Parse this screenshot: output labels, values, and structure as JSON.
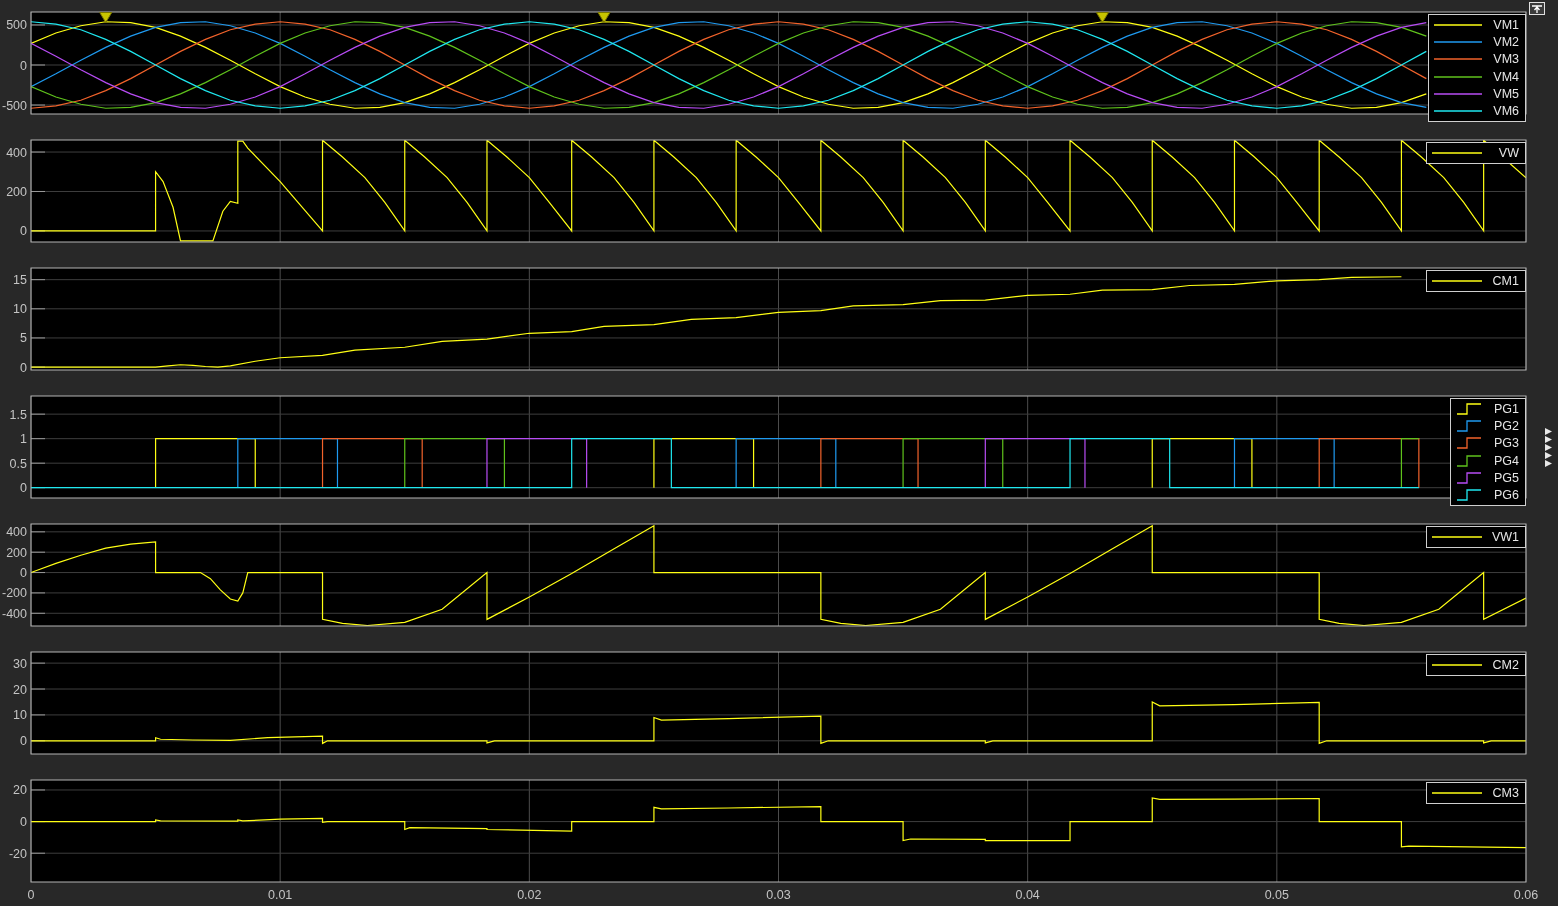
{
  "panels": [
    {
      "kind": "line",
      "peak_markers": true,
      "chart_data": {
        "type": "line",
        "grid": true,
        "xlim": [
          0,
          0.06
        ],
        "ylim": [
          -612,
          662
        ],
        "yticks": [
          -500,
          0,
          500
        ],
        "x": [
          0,
          0.001,
          0.002,
          0.003,
          0.004,
          0.005,
          0.006,
          0.007,
          0.008,
          0.009,
          0.01,
          0.011,
          0.012,
          0.013,
          0.014,
          0.015,
          0.016,
          0.017,
          0.018,
          0.019,
          0.02,
          0.021,
          0.022,
          0.023,
          0.024,
          0.025,
          0.026,
          0.027,
          0.028,
          0.029,
          0.03,
          0.031,
          0.032,
          0.033,
          0.034,
          0.035,
          0.036,
          0.037,
          0.038,
          0.039,
          0.04,
          0.041,
          0.042,
          0.043,
          0.044,
          0.045,
          0.046,
          0.047,
          0.048,
          0.049,
          0.05,
          0.051,
          0.052,
          0.053,
          0.054,
          0.055,
          0.056
        ],
        "series": [
          {
            "name": "VM1",
            "color": "#ffff14",
            "values": [
              270,
              400,
              490,
              540,
              530,
              470,
              360,
              220,
              60,
              -110,
              -270,
              -400,
              -490,
              -540,
              -530,
              -470,
              -360,
              -220,
              -60,
              110,
              270,
              400,
              490,
              540,
              530,
              470,
              360,
              220,
              60,
              -110,
              -270,
              -400,
              -490,
              -540,
              -530,
              -470,
              -360,
              -220,
              -60,
              110,
              270,
              400,
              490,
              540,
              530,
              470,
              360,
              220,
              60,
              -110,
              -270,
              -400,
              -490,
              -540,
              -530,
              -470,
              -360
            ]
          },
          {
            "name": "VM2",
            "color": "#1f9af0",
            "values": [
              -270,
              -110,
              60,
              220,
              360,
              470,
              530,
              540,
              490,
              400,
              270,
              110,
              -60,
              -220,
              -360,
              -470,
              -530,
              -540,
              -490,
              -400,
              -270,
              -110,
              60,
              220,
              360,
              470,
              530,
              540,
              490,
              400,
              270,
              110,
              -60,
              -220,
              -360,
              -470,
              -530,
              -540,
              -490,
              -400,
              -270,
              -110,
              60,
              220,
              360,
              470,
              530,
              540,
              490,
              400,
              270,
              110,
              -60,
              -220,
              -360,
              -470,
              -530
            ]
          },
          {
            "name": "VM3",
            "color": "#f2632b",
            "values": [
              -540,
              -510,
              -440,
              -320,
              -170,
              0,
              170,
              320,
              440,
              510,
              540,
              510,
              440,
              320,
              170,
              0,
              -170,
              -320,
              -440,
              -510,
              -540,
              -510,
              -440,
              -320,
              -170,
              0,
              170,
              320,
              440,
              510,
              540,
              510,
              440,
              320,
              170,
              0,
              -170,
              -320,
              -440,
              -510,
              -540,
              -510,
              -440,
              -320,
              -170,
              0,
              170,
              320,
              440,
              510,
              540,
              510,
              440,
              320,
              170,
              0,
              -170
            ]
          },
          {
            "name": "VM4",
            "color": "#5fc21c",
            "values": [
              -270,
              -400,
              -490,
              -540,
              -530,
              -470,
              -360,
              -220,
              -60,
              110,
              270,
              400,
              490,
              540,
              530,
              470,
              360,
              220,
              60,
              -110,
              -270,
              -400,
              -490,
              -540,
              -530,
              -470,
              -360,
              -220,
              -60,
              110,
              270,
              400,
              490,
              540,
              530,
              470,
              360,
              220,
              60,
              -110,
              -270,
              -400,
              -490,
              -540,
              -530,
              -470,
              -360,
              -220,
              -60,
              110,
              270,
              400,
              490,
              540,
              530,
              470,
              360
            ]
          },
          {
            "name": "VM5",
            "color": "#b84cf5",
            "values": [
              270,
              110,
              -60,
              -220,
              -360,
              -470,
              -530,
              -540,
              -490,
              -400,
              -270,
              -110,
              60,
              220,
              360,
              470,
              530,
              540,
              490,
              400,
              270,
              110,
              -60,
              -220,
              -360,
              -470,
              -530,
              -540,
              -490,
              -400,
              -270,
              -110,
              60,
              220,
              360,
              470,
              530,
              540,
              490,
              400,
              270,
              110,
              -60,
              -220,
              -360,
              -470,
              -530,
              -540,
              -490,
              -400,
              -270,
              -110,
              60,
              220,
              360,
              470,
              530
            ]
          },
          {
            "name": "VM6",
            "color": "#1fe8f0",
            "values": [
              540,
              510,
              440,
              320,
              170,
              0,
              -170,
              -320,
              -440,
              -510,
              -540,
              -510,
              -440,
              -320,
              -170,
              0,
              170,
              320,
              440,
              510,
              540,
              510,
              440,
              320,
              170,
              0,
              -170,
              -320,
              -440,
              -510,
              -540,
              -510,
              -440,
              -320,
              -170,
              0,
              170,
              320,
              440,
              510,
              540,
              510,
              440,
              320,
              170,
              0,
              -170,
              -320,
              -440,
              -510,
              -540,
              -510,
              -440,
              -320,
              -170,
              0,
              170
            ]
          }
        ]
      }
    },
    {
      "kind": "line",
      "chart_data": {
        "type": "line",
        "grid": true,
        "xlim": [
          0,
          0.06
        ],
        "ylim": [
          -56,
          461
        ],
        "yticks": [
          0,
          200,
          400
        ],
        "x": [
          0,
          0.005,
          0.005,
          0.0053,
          0.0057,
          0.006,
          0.0073,
          0.0077,
          0.008,
          0.0083,
          0.0083,
          0.0085,
          0.0087,
          0.01,
          0.0117,
          0.0117,
          0.0125,
          0.0134,
          0.0142,
          0.015,
          0.015,
          0.0158,
          0.0167,
          0.0175,
          0.0183,
          0.0183,
          0.0191,
          0.02,
          0.0208,
          0.0217,
          0.0217,
          0.0225,
          0.0234,
          0.0242,
          0.025,
          0.025,
          0.0258,
          0.0267,
          0.0275,
          0.0283,
          0.0283,
          0.0291,
          0.03,
          0.0308,
          0.0317,
          0.0317,
          0.0325,
          0.0334,
          0.0342,
          0.035,
          0.035,
          0.0358,
          0.0367,
          0.0375,
          0.0383,
          0.0383,
          0.0391,
          0.04,
          0.0408,
          0.0417,
          0.0417,
          0.0425,
          0.0434,
          0.0442,
          0.045,
          0.045,
          0.0458,
          0.0467,
          0.0475,
          0.0483,
          0.0483,
          0.0491,
          0.05,
          0.0508,
          0.0517,
          0.0517,
          0.0525,
          0.0534,
          0.0542,
          0.055,
          0.055,
          0.0558,
          0.0567,
          0.0575,
          0.0583,
          0.0583,
          0.06
        ],
        "series": [
          {
            "name": "VW",
            "color": "#ffff14",
            "values": [
              0,
              0,
              300,
              250,
              120,
              -50,
              -50,
              100,
              150,
              140,
              455,
              455,
              420,
              250,
              0,
              460,
              375,
              270,
              145,
              0,
              460,
              375,
              270,
              145,
              0,
              460,
              375,
              270,
              145,
              0,
              460,
              375,
              270,
              145,
              0,
              460,
              375,
              270,
              145,
              0,
              460,
              375,
              270,
              145,
              0,
              460,
              375,
              270,
              145,
              0,
              460,
              375,
              270,
              145,
              0,
              460,
              375,
              270,
              145,
              0,
              460,
              375,
              270,
              145,
              0,
              460,
              375,
              270,
              145,
              0,
              460,
              375,
              270,
              145,
              0,
              460,
              375,
              270,
              145,
              0,
              460,
              375,
              270,
              145,
              0,
              460,
              270
            ]
          }
        ]
      }
    },
    {
      "kind": "line",
      "chart_data": {
        "type": "line",
        "grid": true,
        "xlim": [
          0,
          0.06
        ],
        "ylim": [
          -0.5,
          17
        ],
        "yticks": [
          0,
          5,
          10,
          15
        ],
        "x": [
          0,
          0.005,
          0.0055,
          0.006,
          0.0065,
          0.007,
          0.0075,
          0.008,
          0.009,
          0.01,
          0.0117,
          0.013,
          0.015,
          0.0165,
          0.0183,
          0.02,
          0.0217,
          0.023,
          0.025,
          0.0265,
          0.0283,
          0.03,
          0.0317,
          0.033,
          0.035,
          0.0365,
          0.0383,
          0.04,
          0.0417,
          0.043,
          0.045,
          0.0465,
          0.0483,
          0.05,
          0.0517,
          0.053,
          0.055
        ],
        "series": [
          {
            "name": "CM1",
            "color": "#ffff14",
            "values": [
              0,
              0,
              0.2,
              0.4,
              0.3,
              0.1,
              0,
              0.2,
              1,
              1.6,
              2,
              2.9,
              3.4,
              4.4,
              4.8,
              5.8,
              6.1,
              7,
              7.3,
              8.2,
              8.5,
              9.4,
              9.7,
              10.5,
              10.7,
              11.4,
              11.5,
              12.3,
              12.5,
              13.2,
              13.3,
              14,
              14.2,
              14.8,
              15,
              15.4,
              15.5
            ]
          }
        ]
      }
    },
    {
      "kind": "step",
      "side_arrows": true,
      "chart_data": {
        "type": "line",
        "grid": true,
        "xlim": [
          0,
          0.06
        ],
        "ylim": [
          -0.21,
          1.87
        ],
        "yticks": [
          0,
          0.5,
          1,
          1.5
        ],
        "x": [
          0,
          0.005,
          0.005,
          0.0083,
          0.0083,
          0.009,
          0.009,
          0.0117,
          0.0117,
          0.0123,
          0.0123,
          0.015,
          0.015,
          0.0157,
          0.0157,
          0.0183,
          0.0183,
          0.019,
          0.019,
          0.0217,
          0.0217,
          0.0223,
          0.0223,
          0.025,
          0.025,
          0.0257,
          0.0257,
          0.0283,
          0.0283,
          0.029,
          0.029,
          0.0317,
          0.0317,
          0.0323,
          0.0323,
          0.035,
          0.035,
          0.0356,
          0.0356,
          0.0383,
          0.0383,
          0.039,
          0.039,
          0.0417,
          0.0417,
          0.0423,
          0.0423,
          0.045,
          0.045,
          0.0457,
          0.0457,
          0.0483,
          0.0483,
          0.049,
          0.049,
          0.0517,
          0.0517,
          0.0523,
          0.0523,
          0.055,
          0.055,
          0.0557,
          0.0557
        ],
        "series": [
          {
            "name": "PG1",
            "color": "#ffff14",
            "values": [
              null,
              0,
              1,
              1,
              1,
              1,
              0,
              null,
              null,
              null,
              null,
              null,
              null,
              null,
              null,
              null,
              null,
              null,
              null,
              null,
              null,
              null,
              null,
              0,
              1,
              1,
              1,
              1,
              1,
              1,
              0,
              null,
              null,
              null,
              null,
              null,
              null,
              null,
              null,
              null,
              null,
              null,
              null,
              null,
              null,
              null,
              null,
              0,
              1,
              1,
              1,
              1,
              1,
              1,
              0,
              null,
              null,
              null,
              null,
              null,
              null,
              null,
              null
            ]
          },
          {
            "name": "PG2",
            "color": "#1f9af0",
            "values": [
              null,
              null,
              null,
              0,
              1,
              1,
              1,
              1,
              1,
              1,
              0,
              null,
              null,
              null,
              null,
              null,
              null,
              null,
              null,
              null,
              null,
              null,
              null,
              null,
              null,
              null,
              null,
              0,
              1,
              1,
              1,
              1,
              1,
              1,
              0,
              null,
              null,
              null,
              null,
              null,
              null,
              null,
              null,
              null,
              null,
              null,
              null,
              null,
              null,
              null,
              null,
              0,
              1,
              1,
              1,
              1,
              1,
              1,
              0,
              null,
              null,
              null,
              null
            ]
          },
          {
            "name": "PG3",
            "color": "#f2632b",
            "values": [
              null,
              null,
              null,
              null,
              null,
              null,
              null,
              0,
              1,
              1,
              1,
              1,
              1,
              1,
              0,
              null,
              null,
              null,
              null,
              null,
              null,
              null,
              null,
              null,
              null,
              null,
              null,
              null,
              null,
              null,
              null,
              0,
              1,
              1,
              1,
              1,
              1,
              1,
              0,
              null,
              null,
              null,
              null,
              null,
              null,
              null,
              null,
              null,
              null,
              null,
              null,
              null,
              null,
              null,
              null,
              0,
              1,
              1,
              1,
              1,
              1,
              1,
              0
            ]
          },
          {
            "name": "PG4",
            "color": "#5fc21c",
            "values": [
              null,
              null,
              null,
              null,
              null,
              null,
              null,
              null,
              null,
              null,
              null,
              0,
              1,
              1,
              1,
              1,
              1,
              1,
              0,
              null,
              null,
              null,
              null,
              null,
              null,
              null,
              null,
              null,
              null,
              null,
              null,
              null,
              null,
              null,
              null,
              0,
              1,
              1,
              1,
              1,
              1,
              1,
              0,
              null,
              null,
              null,
              null,
              null,
              null,
              null,
              null,
              null,
              null,
              null,
              null,
              null,
              null,
              null,
              null,
              0,
              1,
              1,
              1
            ]
          },
          {
            "name": "PG5",
            "color": "#b84cf5",
            "values": [
              null,
              null,
              null,
              null,
              null,
              null,
              null,
              null,
              null,
              null,
              null,
              null,
              null,
              null,
              null,
              0,
              1,
              1,
              1,
              1,
              1,
              1,
              0,
              null,
              null,
              null,
              null,
              null,
              null,
              null,
              null,
              null,
              null,
              null,
              null,
              null,
              null,
              null,
              null,
              0,
              1,
              1,
              1,
              1,
              1,
              1,
              0,
              null,
              null,
              null,
              null,
              null,
              null,
              null,
              null,
              null,
              null,
              null,
              null,
              null,
              null,
              null,
              null
            ]
          },
          {
            "name": "PG6",
            "color": "#1fe8f0",
            "values": [
              0,
              0,
              0,
              0,
              0,
              0,
              0,
              0,
              0,
              0,
              0,
              0,
              0,
              0,
              0,
              0,
              0,
              0,
              0,
              0,
              1,
              1,
              1,
              1,
              1,
              1,
              0,
              0,
              0,
              0,
              0,
              0,
              0,
              0,
              0,
              0,
              0,
              0,
              0,
              0,
              0,
              0,
              0,
              0,
              1,
              1,
              1,
              1,
              1,
              1,
              0,
              0,
              0,
              0,
              0,
              0,
              0,
              0,
              0,
              0,
              0,
              0,
              0
            ]
          }
        ]
      }
    },
    {
      "kind": "line",
      "chart_data": {
        "type": "line",
        "grid": true,
        "xlim": [
          0,
          0.06
        ],
        "ylim": [
          -525,
          477
        ],
        "yticks": [
          -400,
          -200,
          0,
          200,
          400
        ],
        "x": [
          0,
          0.001,
          0.002,
          0.003,
          0.004,
          0.005,
          0.005,
          0.0068,
          0.0072,
          0.0076,
          0.008,
          0.0083,
          0.0085,
          0.0087,
          0.0117,
          0.0117,
          0.0125,
          0.0135,
          0.015,
          0.0165,
          0.0183,
          0.0183,
          0.02,
          0.0217,
          0.0233,
          0.025,
          0.025,
          0.0317,
          0.0317,
          0.0325,
          0.0335,
          0.035,
          0.0365,
          0.0383,
          0.0383,
          0.04,
          0.0417,
          0.0433,
          0.045,
          0.045,
          0.0517,
          0.0517,
          0.0525,
          0.0535,
          0.055,
          0.0565,
          0.0583,
          0.0583,
          0.06
        ],
        "series": [
          {
            "name": "VW1",
            "color": "#ffff14",
            "values": [
              0,
              90,
              170,
              240,
              280,
              300,
              0,
              0,
              -60,
              -170,
              -260,
              -280,
              -200,
              0,
              0,
              -460,
              -500,
              -520,
              -490,
              -360,
              0,
              -460,
              -240,
              -10,
              220,
              460,
              0,
              0,
              -460,
              -500,
              -520,
              -490,
              -360,
              0,
              -460,
              -240,
              -10,
              220,
              460,
              0,
              0,
              -460,
              -500,
              -520,
              -490,
              -360,
              0,
              -460,
              -250
            ]
          }
        ]
      }
    },
    {
      "kind": "line",
      "chart_data": {
        "type": "line",
        "grid": true,
        "xlim": [
          0,
          0.06
        ],
        "ylim": [
          -5.1,
          34.3
        ],
        "yticks": [
          0,
          10,
          20,
          30
        ],
        "x": [
          0,
          0.005,
          0.005,
          0.0052,
          0.0065,
          0.008,
          0.0095,
          0.0117,
          0.0117,
          0.0119,
          0.0183,
          0.0183,
          0.0186,
          0.025,
          0.025,
          0.0253,
          0.028,
          0.0317,
          0.0317,
          0.032,
          0.0383,
          0.0383,
          0.0386,
          0.045,
          0.045,
          0.0453,
          0.0483,
          0.0517,
          0.0517,
          0.052,
          0.0583,
          0.0583,
          0.0586,
          0.06
        ],
        "series": [
          {
            "name": "CM2",
            "color": "#ffff14",
            "values": [
              0,
              0,
              1.2,
              0.6,
              0.3,
              0.2,
              1.2,
              1.8,
              -1,
              0,
              0,
              -0.8,
              0,
              0,
              9,
              8,
              8.6,
              9.5,
              -1,
              0,
              0,
              -0.8,
              0,
              0,
              15,
              13.5,
              14,
              14.8,
              -1,
              0,
              0,
              -0.8,
              0,
              0
            ]
          }
        ]
      }
    },
    {
      "kind": "line",
      "chart_data": {
        "type": "line",
        "grid": true,
        "xlim": [
          0,
          0.06
        ],
        "ylim": [
          -38.2,
          26.3
        ],
        "yticks": [
          -20,
          0,
          20
        ],
        "xticks": [
          {
            "value": 0,
            "label": "0"
          },
          {
            "value": 0.01,
            "label": "0.01"
          },
          {
            "value": 0.02,
            "label": "0.02"
          },
          {
            "value": 0.03,
            "label": "0.03"
          },
          {
            "value": 0.04,
            "label": "0.04"
          },
          {
            "value": 0.05,
            "label": "0.05"
          },
          {
            "value": 0.06,
            "label": "0.06"
          }
        ],
        "x": [
          0,
          0.005,
          0.005,
          0.0052,
          0.0083,
          0.0083,
          0.0085,
          0.01,
          0.0117,
          0.0117,
          0.0119,
          0.015,
          0.015,
          0.0152,
          0.0183,
          0.0183,
          0.0217,
          0.0217,
          0.025,
          0.025,
          0.0253,
          0.028,
          0.0317,
          0.0317,
          0.035,
          0.035,
          0.0353,
          0.0383,
          0.0383,
          0.0417,
          0.0417,
          0.045,
          0.045,
          0.0453,
          0.0483,
          0.0517,
          0.0517,
          0.055,
          0.055,
          0.0553,
          0.06
        ],
        "series": [
          {
            "name": "CM3",
            "color": "#ffff14",
            "values": [
              0,
              0,
              1,
              0.4,
              0.3,
              1,
              0.4,
              1.5,
              2,
              -0.5,
              0,
              0,
              -5,
              -3.8,
              -4.5,
              -5,
              -6,
              0,
              0,
              9,
              8,
              8.6,
              9.5,
              0,
              0,
              -12,
              -11,
              -11.3,
              -12,
              -12,
              0,
              0,
              15,
              14,
              14.2,
              14.6,
              0,
              0,
              -16,
              -15.5,
              -16.5
            ]
          }
        ]
      }
    }
  ]
}
